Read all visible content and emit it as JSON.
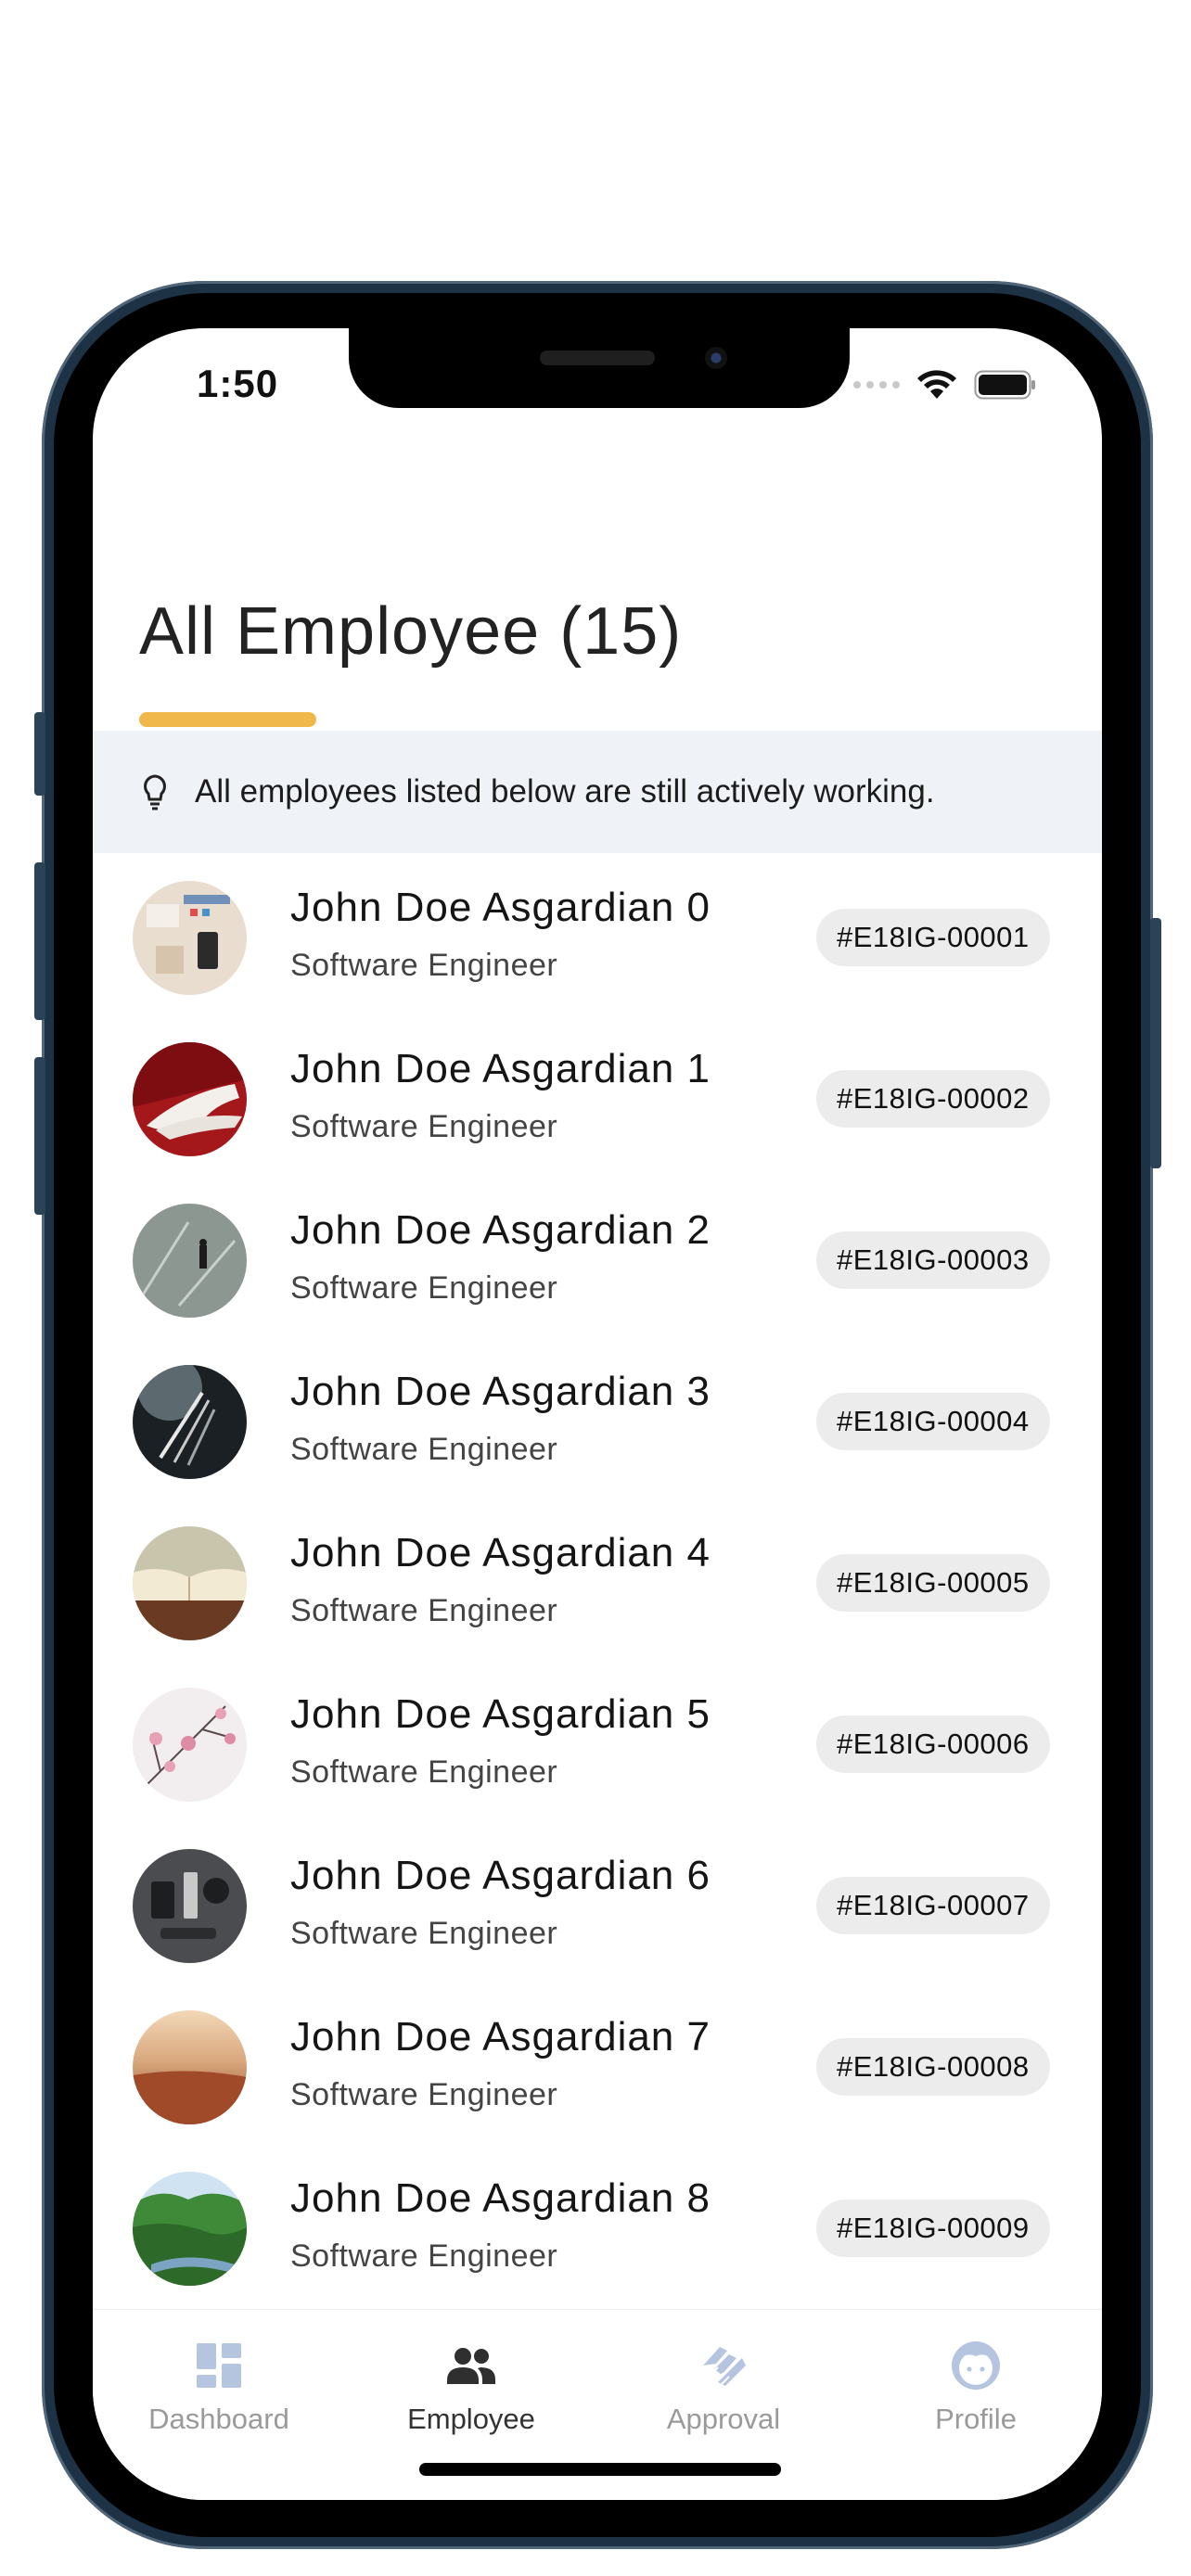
{
  "status_bar": {
    "time": "1:50"
  },
  "header": {
    "title": "All Employee (15)"
  },
  "info_banner": {
    "text": "All employees listed below are still actively working."
  },
  "employees": [
    {
      "name": "John Doe Asgardian 0",
      "role": "Software Engineer",
      "id": "#E18IG-00001"
    },
    {
      "name": "John Doe Asgardian 1",
      "role": "Software Engineer",
      "id": "#E18IG-00002"
    },
    {
      "name": "John Doe Asgardian 2",
      "role": "Software Engineer",
      "id": "#E18IG-00003"
    },
    {
      "name": "John Doe Asgardian 3",
      "role": "Software Engineer",
      "id": "#E18IG-00004"
    },
    {
      "name": "John Doe Asgardian 4",
      "role": "Software Engineer",
      "id": "#E18IG-00005"
    },
    {
      "name": "John Doe Asgardian 5",
      "role": "Software Engineer",
      "id": "#E18IG-00006"
    },
    {
      "name": "John Doe Asgardian 6",
      "role": "Software Engineer",
      "id": "#E18IG-00007"
    },
    {
      "name": "John Doe Asgardian 7",
      "role": "Software Engineer",
      "id": "#E18IG-00008"
    },
    {
      "name": "John Doe Asgardian 8",
      "role": "Software Engineer",
      "id": "#E18IG-00009"
    }
  ],
  "bottom_nav": {
    "items": [
      {
        "label": "Dashboard",
        "icon": "dashboard-icon",
        "active": false
      },
      {
        "label": "Employee",
        "icon": "people-icon",
        "active": true
      },
      {
        "label": "Approval",
        "icon": "handshake-icon",
        "active": false
      },
      {
        "label": "Profile",
        "icon": "face-icon",
        "active": false
      }
    ]
  },
  "colors": {
    "accent_underline": "#f0b84a",
    "banner_bg": "#eff3f7",
    "badge_bg": "#ececec",
    "nav_inactive_icon": "#b5c5e0",
    "nav_active_icon": "#2f2f2f",
    "phone_frame": "#1d3244"
  }
}
